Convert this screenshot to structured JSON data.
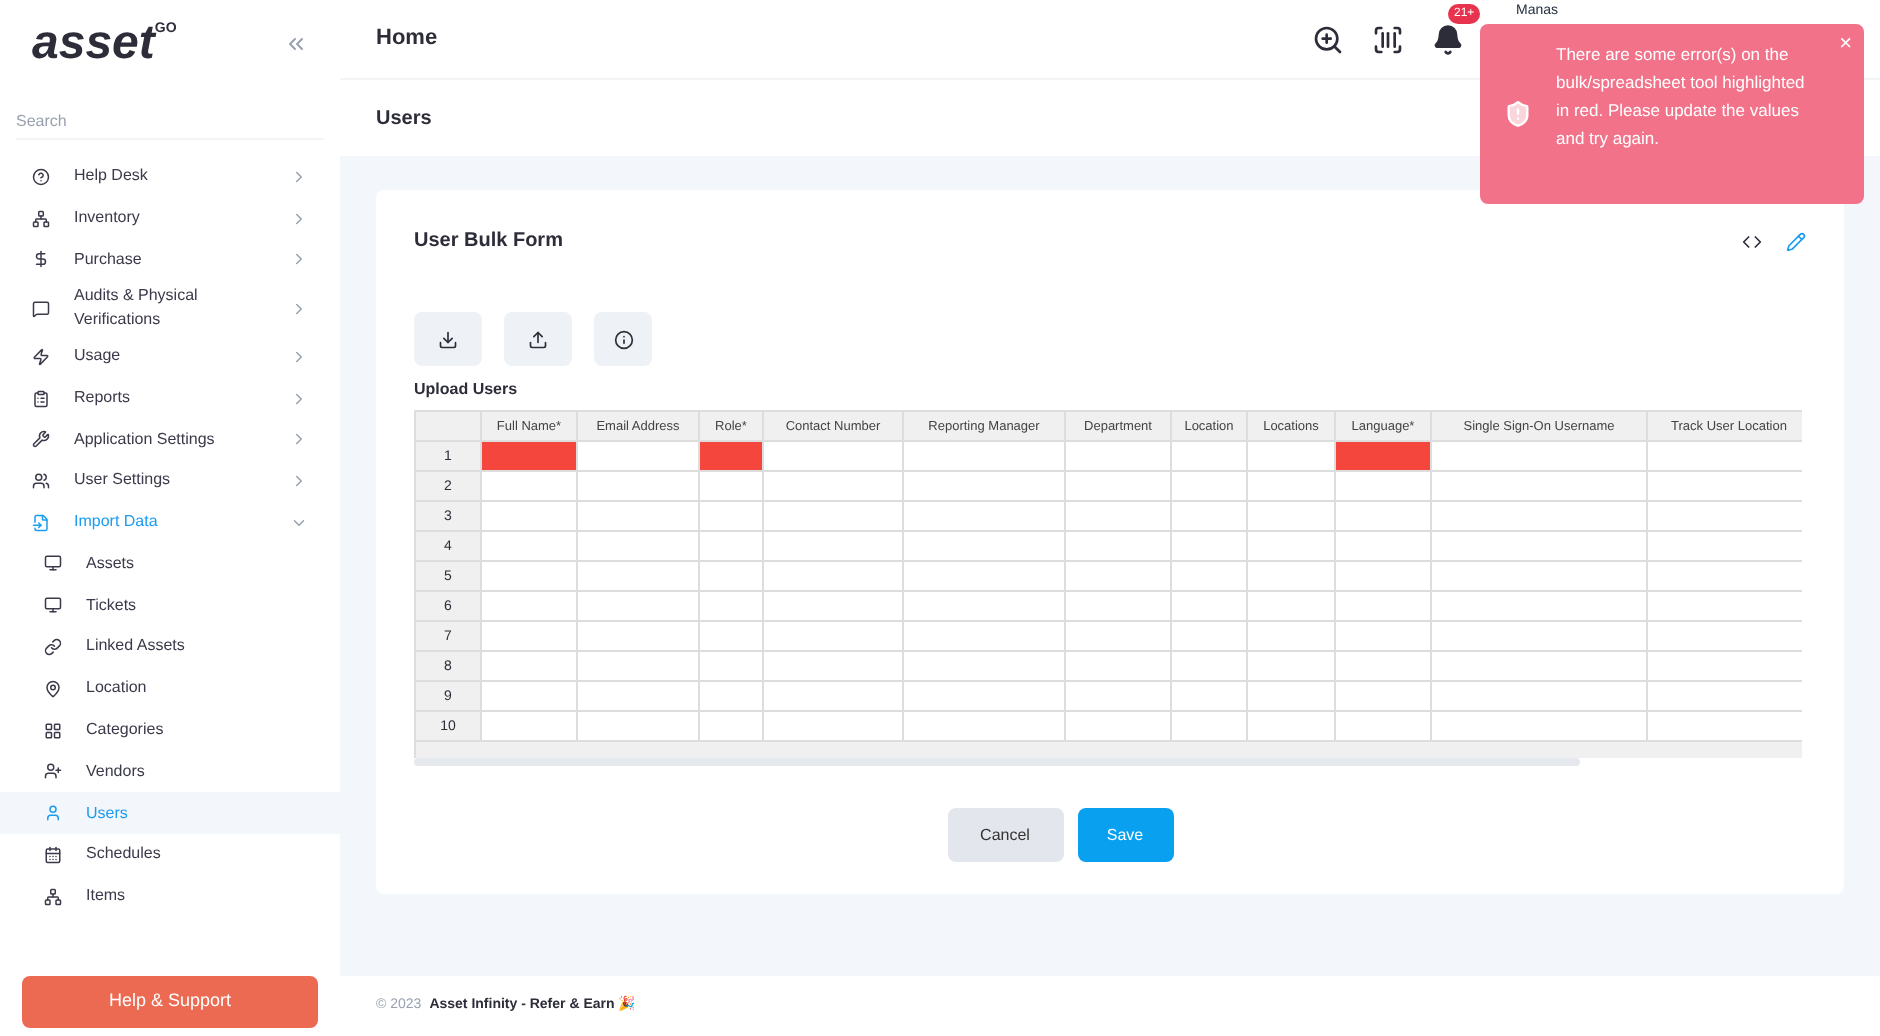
{
  "sidebar": {
    "logo": "asset",
    "logo_sup": "GO",
    "search": {
      "placeholder": "Search"
    },
    "items": [
      {
        "label": "Help Desk",
        "kind": "help",
        "selected": false,
        "expanded": false
      },
      {
        "label": "Inventory",
        "kind": "network",
        "selected": false,
        "expanded": false
      },
      {
        "label": "Purchase",
        "kind": "dollar",
        "selected": false,
        "expanded": false
      },
      {
        "label": "Audits & Physical Verifications",
        "kind": "chat",
        "selected": false,
        "expanded": false
      },
      {
        "label": "Usage",
        "kind": "bolt",
        "selected": false,
        "expanded": false
      },
      {
        "label": "Reports",
        "kind": "clipboard",
        "selected": false,
        "expanded": false
      },
      {
        "label": "Application Settings",
        "kind": "wrench",
        "selected": false,
        "expanded": false
      },
      {
        "label": "User Settings",
        "kind": "users",
        "selected": false,
        "expanded": false
      },
      {
        "label": "Import Data",
        "kind": "import",
        "selected": true,
        "expanded": true,
        "children": [
          {
            "label": "Assets",
            "kind": "monitor",
            "selected": false
          },
          {
            "label": "Tickets",
            "kind": "monitor",
            "selected": false
          },
          {
            "label": "Linked Assets",
            "kind": "link",
            "selected": false
          },
          {
            "label": "Location",
            "kind": "pin",
            "selected": false
          },
          {
            "label": "Categories",
            "kind": "grid",
            "selected": false
          },
          {
            "label": "Vendors",
            "kind": "userplus",
            "selected": false
          },
          {
            "label": "Users",
            "kind": "user",
            "selected": true
          },
          {
            "label": "Schedules",
            "kind": "calendar",
            "selected": false
          },
          {
            "label": "Items",
            "kind": "network",
            "selected": false
          }
        ]
      }
    ],
    "help_button": "Help & Support"
  },
  "header": {
    "title": "Home",
    "notification_count": "21+",
    "user_name": "Manas"
  },
  "breadcrumb": "Users",
  "form": {
    "title": "User Bulk Form",
    "grid_label": "Upload Users",
    "columns": [
      "Full Name*",
      "Email Address",
      "Role*",
      "Contact Number",
      "Reporting Manager",
      "Department",
      "Location",
      "Locations",
      "Language*",
      "Single Sign-On Username",
      "Track User Location"
    ],
    "rows": [
      {
        "label": "1",
        "errors": [
          true,
          false,
          true,
          false,
          false,
          false,
          false,
          false,
          true,
          false,
          false
        ]
      },
      {
        "label": "2",
        "errors": []
      },
      {
        "label": "3",
        "errors": []
      },
      {
        "label": "4",
        "errors": []
      },
      {
        "label": "5",
        "errors": []
      },
      {
        "label": "6",
        "errors": []
      },
      {
        "label": "7",
        "errors": []
      },
      {
        "label": "8",
        "errors": []
      },
      {
        "label": "9",
        "errors": []
      },
      {
        "label": "10",
        "errors": []
      }
    ],
    "buttons": [
      {
        "label": "Cancel",
        "kind": "secondary"
      },
      {
        "label": "Save",
        "kind": "primary"
      }
    ]
  },
  "footer": {
    "year": "© 2023",
    "text": "Asset Infinity - Refer & Earn 🎉"
  },
  "toast": {
    "message": "There are some error(s) on the bulk/spreadsheet tool highlighted in red. Please update the values and try again.",
    "close": "×"
  }
}
